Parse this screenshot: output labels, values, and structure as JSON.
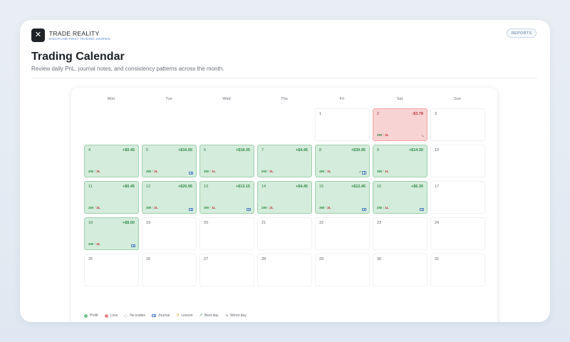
{
  "brand": {
    "name": "TRADE REALITY",
    "tagline": "DISCIPLINE-FIRST TRADING JOURNAL",
    "logo_icon": "x-mark-icon"
  },
  "header": {
    "reports_label": "REPORTS"
  },
  "page": {
    "title": "Trading Calendar",
    "subtitle": "Review daily PnL, journal notes, and consistency patterns across the month."
  },
  "calendar": {
    "weekdays": [
      "Mon",
      "Tue",
      "Wed",
      "Thu",
      "Fri",
      "Sat",
      "Sun"
    ],
    "wl_separator": "/",
    "cells": [
      {
        "day": "",
        "status": "empty"
      },
      {
        "day": "",
        "status": "empty"
      },
      {
        "day": "",
        "status": "empty"
      },
      {
        "day": "",
        "status": "empty"
      },
      {
        "day": "1",
        "status": "none"
      },
      {
        "day": "2",
        "status": "loss",
        "pnl": "-$3.78",
        "wins": "2W",
        "losses": "2L",
        "icons": [
          "worst"
        ]
      },
      {
        "day": "3",
        "status": "none"
      },
      {
        "day": "4",
        "status": "profit",
        "pnl": "+$0.45",
        "wins": "2W",
        "losses": "2L",
        "icons": []
      },
      {
        "day": "5",
        "status": "profit",
        "pnl": "+$16.55",
        "wins": "4W",
        "losses": "2L",
        "icons": [
          "journal"
        ]
      },
      {
        "day": "6",
        "status": "profit",
        "pnl": "+$18.35",
        "wins": "3W",
        "losses": "1L",
        "icons": []
      },
      {
        "day": "7",
        "status": "profit",
        "pnl": "+$4.45",
        "wins": "2W",
        "losses": "2L",
        "icons": []
      },
      {
        "day": "8",
        "status": "profit",
        "pnl": "+$30.95",
        "wins": "4W",
        "losses": "1L",
        "icons": [
          "best",
          "journal"
        ]
      },
      {
        "day": "9",
        "status": "profit",
        "pnl": "+$14.30",
        "wins": "3W",
        "losses": "1L",
        "icons": []
      },
      {
        "day": "10",
        "status": "none"
      },
      {
        "day": "11",
        "status": "profit",
        "pnl": "+$0.45",
        "wins": "2W",
        "losses": "2L",
        "icons": []
      },
      {
        "day": "12",
        "status": "profit",
        "pnl": "+$20.95",
        "wins": "4W",
        "losses": "2L",
        "icons": [
          "journal"
        ]
      },
      {
        "day": "13",
        "status": "profit",
        "pnl": "+$13.15",
        "wins": "3W",
        "losses": "1L",
        "icons": [
          "journal"
        ]
      },
      {
        "day": "14",
        "status": "profit",
        "pnl": "+$4.45",
        "wins": "2W",
        "losses": "2L",
        "icons": []
      },
      {
        "day": "15",
        "status": "profit",
        "pnl": "+$12.45",
        "wins": "3W",
        "losses": "2L",
        "icons": [
          "journal"
        ]
      },
      {
        "day": "16",
        "status": "profit",
        "pnl": "+$6.30",
        "wins": "2W",
        "losses": "1L",
        "icons": [
          "journal"
        ]
      },
      {
        "day": "17",
        "status": "none"
      },
      {
        "day": "18",
        "status": "profit",
        "pnl": "+$8.50",
        "wins": "2W",
        "losses": "2L",
        "icons": [
          "journal"
        ]
      },
      {
        "day": "19",
        "status": "none"
      },
      {
        "day": "20",
        "status": "none"
      },
      {
        "day": "21",
        "status": "none"
      },
      {
        "day": "22",
        "status": "none"
      },
      {
        "day": "23",
        "status": "none"
      },
      {
        "day": "24",
        "status": "none"
      },
      {
        "day": "25",
        "status": "none"
      },
      {
        "day": "26",
        "status": "none"
      },
      {
        "day": "27",
        "status": "none"
      },
      {
        "day": "28",
        "status": "none"
      },
      {
        "day": "29",
        "status": "none"
      },
      {
        "day": "30",
        "status": "none"
      },
      {
        "day": "31",
        "status": "none"
      }
    ]
  },
  "legend": {
    "profit": "Profit",
    "loss": "Loss",
    "no_trades": "No trades",
    "journal": "Journal",
    "lesson": "Lesson",
    "best_day": "Best day",
    "worst_day": "Worst day"
  },
  "colors": {
    "profit_bg": "#d4ecdb",
    "profit_text": "#2e8b46",
    "loss_bg": "#f7d3d3",
    "loss_text": "#c0353b",
    "journal_blue": "#4f7fc4"
  }
}
